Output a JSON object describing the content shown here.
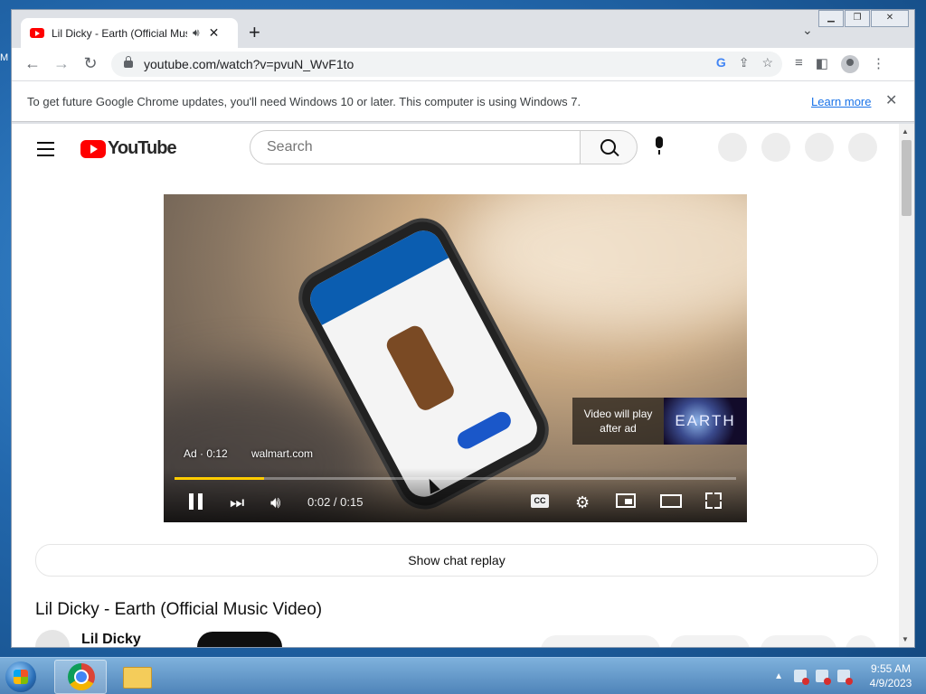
{
  "browser": {
    "tab_title": "Lil Dicky - Earth (Official Mus",
    "tab_audio_icon": "speaker-icon",
    "url": "youtube.com/watch?v=pvuN_WvF1to",
    "infobar_message": "To get future Google Chrome updates, you'll need Windows 10 or later. This computer is using Windows 7.",
    "infobar_link": "Learn more"
  },
  "youtube": {
    "logo_text": "YouTube",
    "search_placeholder": "Search",
    "player": {
      "ad_label": "Ad · 0:12",
      "ad_link": "walmart.com",
      "next_label_line1": "Video will play",
      "next_label_line2": "after ad",
      "next_thumb_text": "EARTH",
      "time": "0:02 / 0:15",
      "progress_fraction": 0.16,
      "cc_label": "CC"
    },
    "chat_replay": "Show chat replay",
    "video_title": "Lil Dicky - Earth (Official Music Video)",
    "channel_name": "Lil Dicky"
  },
  "taskbar": {
    "time": "9:55 AM",
    "date": "4/9/2023"
  },
  "colors": {
    "youtube_red": "#ff0000",
    "progress_yellow": "#ffcc00",
    "link_blue": "#1a73e8"
  }
}
